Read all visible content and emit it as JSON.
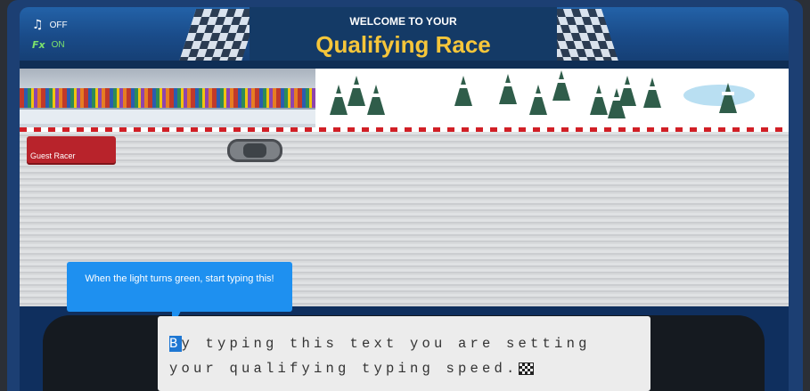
{
  "hud": {
    "music": {
      "icon": "music-note-icon",
      "glyph": "♫",
      "label": "OFF"
    },
    "fx": {
      "icon": "fx-icon",
      "glyph": "Fx",
      "label": "ON"
    }
  },
  "banner": {
    "welcome": "WELCOME TO YOUR",
    "title": "Qualifying Race"
  },
  "track": {
    "racer_name": "Guest Racer"
  },
  "tooltip": {
    "text": "When the light turns green, start typing this!"
  },
  "typing": {
    "first_char": "B",
    "rest": "y typing this text you are setting your qualifying typing speed."
  },
  "colors": {
    "accent_blue": "#1e90f0",
    "title_gold": "#f6c63a",
    "racer_red": "#b8232b"
  }
}
